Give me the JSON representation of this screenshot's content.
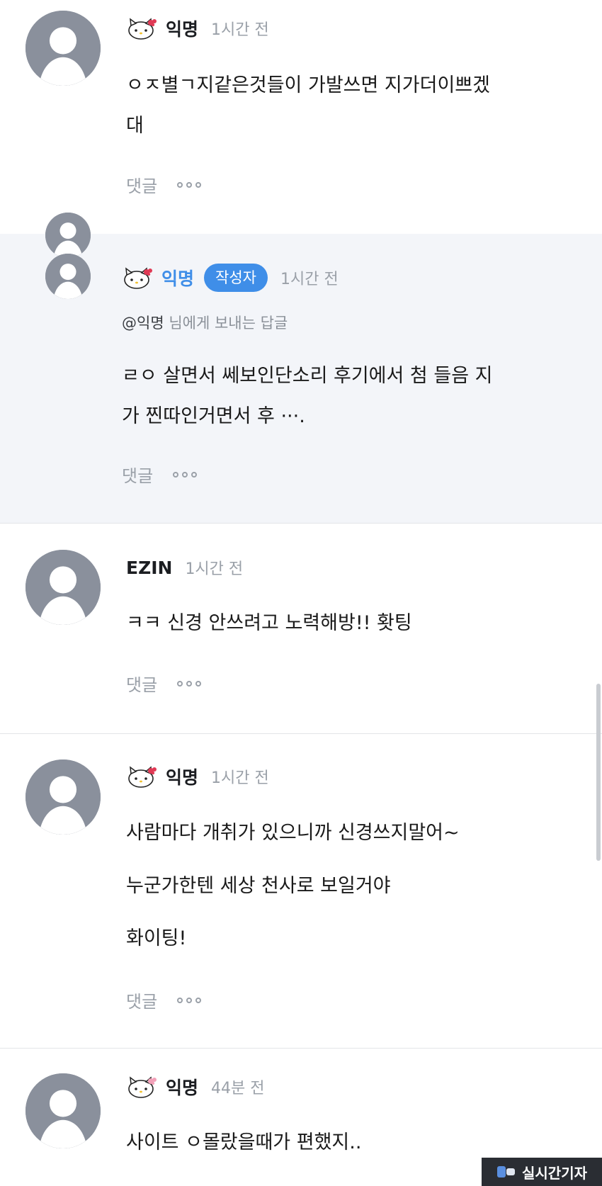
{
  "comments": [
    {
      "author": "익명",
      "time": "1시간 전",
      "lines": [
        "ㅇㅈ별ㄱ지같은것들이 가발쓰면 지가더이쁘겠",
        "대"
      ],
      "reply_label": "댓글"
    },
    {
      "author": "익명",
      "badge": "작성자",
      "time": "1시간 전",
      "mention": "@익명",
      "reply_to_text": "님에게 보내는 답글",
      "lines": [
        "ㄹㅇ 살면서 쎄보인단소리 후기에서 첨 들음 지",
        "가 찐따인거면서 후 ···."
      ],
      "reply_label": "댓글"
    },
    {
      "author": "EZIN",
      "time": "1시간 전",
      "lines": [
        "ㅋㅋ 신경 안쓰려고 노력해방!! 홧팅"
      ],
      "reply_label": "댓글"
    },
    {
      "author": "익명",
      "time": "1시간 전",
      "lines": [
        "사람마다 개취가 있으니까 신경쓰지말어~",
        "누군가한텐 세상 천사로 보일거야",
        "화이팅!"
      ],
      "reply_label": "댓글"
    },
    {
      "author": "익명",
      "time": "44분 전",
      "lines": [
        "사이트 ㅇ몰랐을때가 편했지.."
      ]
    }
  ],
  "watermark": {
    "text": "실시간기자"
  },
  "icons": {
    "avatar": "default-avatar-icon",
    "kitty": "hello-kitty-icon",
    "more": "more-dots-icon"
  },
  "colors": {
    "accent": "#3f8ee8",
    "reply_bg": "#f3f5f9",
    "avatar": "#8a909c",
    "muted": "#9aa0a8"
  }
}
